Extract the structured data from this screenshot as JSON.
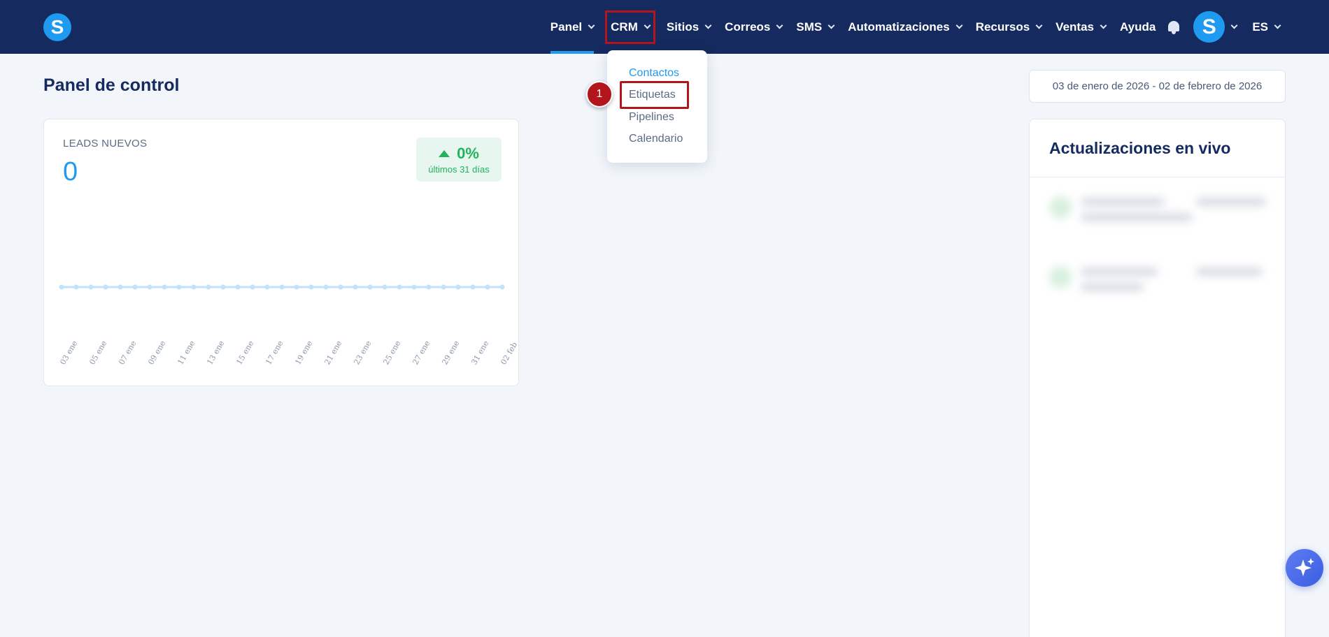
{
  "brand": {
    "logo_letter": "S"
  },
  "nav": {
    "items": [
      {
        "label": "Panel"
      },
      {
        "label": "CRM"
      },
      {
        "label": "Sitios"
      },
      {
        "label": "Correos"
      },
      {
        "label": "SMS"
      },
      {
        "label": "Automatizaciones"
      },
      {
        "label": "Recursos"
      },
      {
        "label": "Ventas"
      }
    ],
    "help_label": "Ayuda",
    "avatar_letter": "S",
    "language": "ES"
  },
  "page": {
    "title": "Panel de control"
  },
  "date_range": {
    "value": "03 de enero de 2026 - 02 de febrero de 2026"
  },
  "crm_menu": {
    "items": [
      {
        "label": "Contactos"
      },
      {
        "label": "Etiquetas"
      },
      {
        "label": "Pipelines"
      },
      {
        "label": "Calendario"
      }
    ],
    "step_badge": "1"
  },
  "leads_card": {
    "label": "LEADS NUEVOS",
    "value": "0",
    "change": "0%",
    "change_caption": "últimos 31 días"
  },
  "chart_data": {
    "type": "line",
    "x": [
      "03 ene",
      "04 ene",
      "05 ene",
      "06 ene",
      "07 ene",
      "08 ene",
      "09 ene",
      "10 ene",
      "11 ene",
      "12 ene",
      "13 ene",
      "14 ene",
      "15 ene",
      "16 ene",
      "17 ene",
      "18 ene",
      "19 ene",
      "20 ene",
      "21 ene",
      "22 ene",
      "23 ene",
      "24 ene",
      "25 ene",
      "26 ene",
      "27 ene",
      "28 ene",
      "29 ene",
      "30 ene",
      "31 ene",
      "01 feb",
      "02 feb"
    ],
    "tick_labels": [
      "03 ene",
      "05 ene",
      "07 ene",
      "09 ene",
      "11 ene",
      "13 ene",
      "15 ene",
      "17 ene",
      "19 ene",
      "21 ene",
      "23 ene",
      "25 ene",
      "27 ene",
      "29 ene",
      "31 ene",
      "02 feb"
    ],
    "series": [
      {
        "values": [
          0,
          0,
          0,
          0,
          0,
          0,
          0,
          0,
          0,
          0,
          0,
          0,
          0,
          0,
          0,
          0,
          0,
          0,
          0,
          0,
          0,
          0,
          0,
          0,
          0,
          0,
          0,
          0,
          0,
          0,
          0
        ]
      }
    ],
    "title": "",
    "xlabel": "",
    "ylabel": "",
    "grid": false,
    "color": "#bfe3f8"
  },
  "live_updates": {
    "title": "Actualizaciones en vivo"
  }
}
